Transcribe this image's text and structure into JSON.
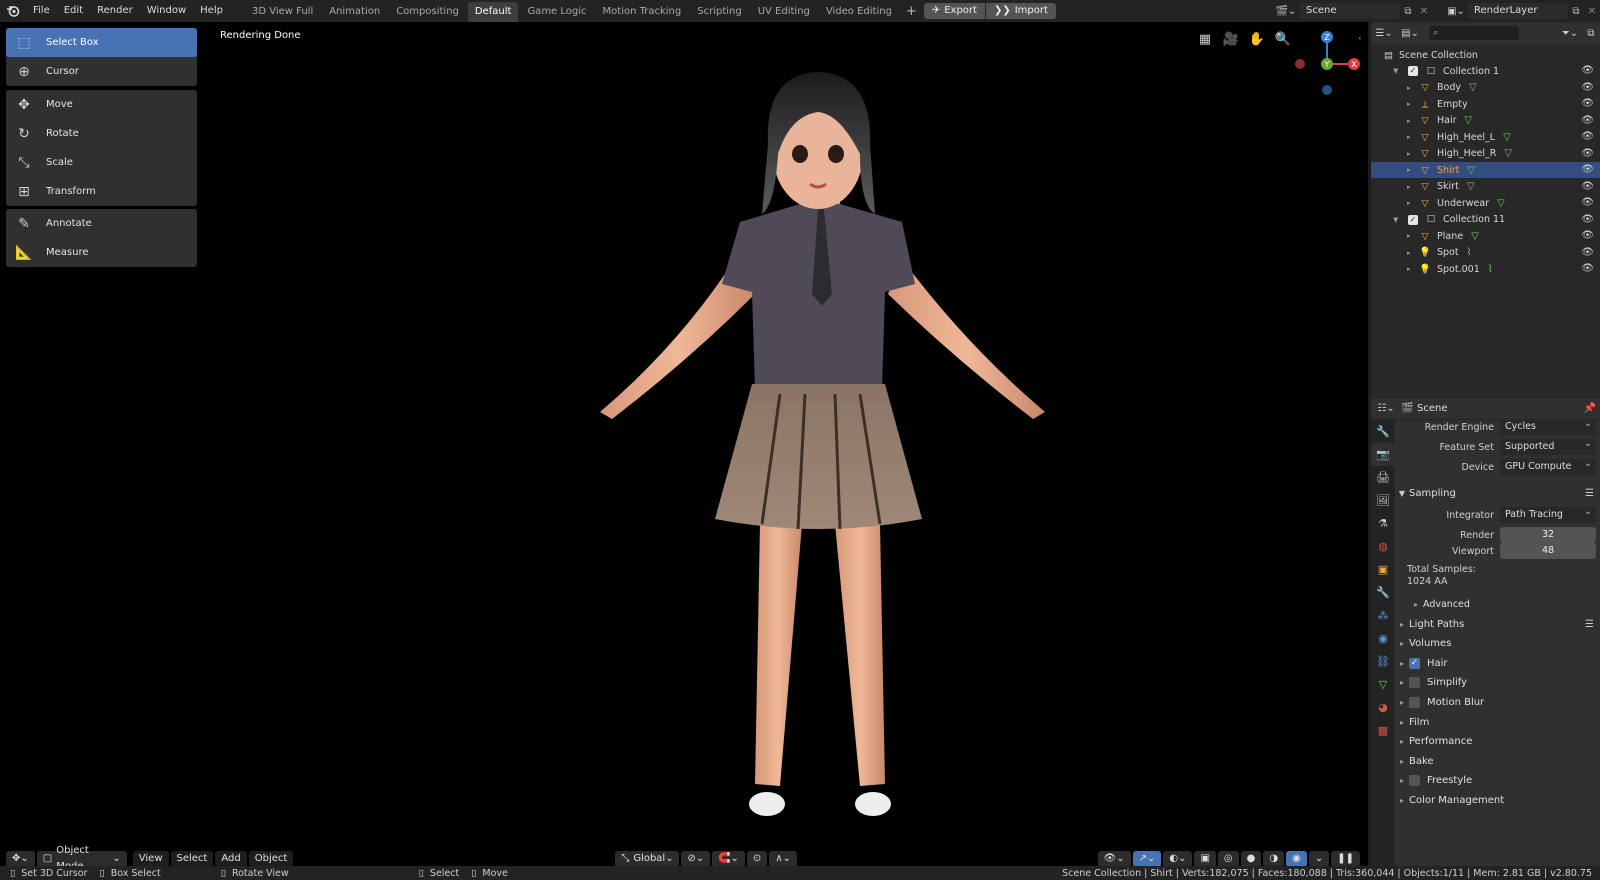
{
  "menu": [
    "File",
    "Edit",
    "Render",
    "Window",
    "Help"
  ],
  "workspace_tabs": [
    {
      "label": "3D View Full",
      "active": false
    },
    {
      "label": "Animation",
      "active": false
    },
    {
      "label": "Compositing",
      "active": false
    },
    {
      "label": "Default",
      "active": true
    },
    {
      "label": "Game Logic",
      "active": false
    },
    {
      "label": "Motion Tracking",
      "active": false
    },
    {
      "label": "Scripting",
      "active": false
    },
    {
      "label": "UV Editing",
      "active": false
    },
    {
      "label": "Video Editing",
      "active": false
    }
  ],
  "topbar": {
    "export_label": "Export",
    "import_label": "Import",
    "scene_name": "Scene",
    "render_layer": "RenderLayer"
  },
  "viewport": {
    "status_text": "Rendering Done",
    "gizmo": {
      "z": "Z",
      "y": "Y",
      "x": "X"
    },
    "header": {
      "mode": "Object Mode",
      "view": "View",
      "select": "Select",
      "add": "Add",
      "object": "Object",
      "orientation": "Global"
    }
  },
  "toolbar": {
    "group1": [
      {
        "label": "Select Box",
        "icon": "select-box-icon",
        "active": true
      },
      {
        "label": "Cursor",
        "icon": "cursor-icon",
        "active": false
      }
    ],
    "group2": [
      {
        "label": "Move",
        "icon": "move-icon"
      },
      {
        "label": "Rotate",
        "icon": "rotate-icon"
      },
      {
        "label": "Scale",
        "icon": "scale-icon"
      },
      {
        "label": "Transform",
        "icon": "transform-icon"
      }
    ],
    "group3": [
      {
        "label": "Annotate",
        "icon": "annotate-icon"
      },
      {
        "label": "Measure",
        "icon": "measure-icon"
      }
    ]
  },
  "outliner": {
    "root": "Scene Collection",
    "items": [
      {
        "name": "Collection 1",
        "type": "collection",
        "depth": 1,
        "selected": false
      },
      {
        "name": "Body",
        "type": "mesh",
        "depth": 2,
        "selected": false
      },
      {
        "name": "Empty",
        "type": "empty",
        "depth": 2,
        "selected": false
      },
      {
        "name": "Hair",
        "type": "mesh",
        "depth": 2,
        "selected": false
      },
      {
        "name": "High_Heel_L",
        "type": "mesh",
        "depth": 2,
        "selected": false
      },
      {
        "name": "High_Heel_R",
        "type": "mesh",
        "depth": 2,
        "selected": false
      },
      {
        "name": "Shirt",
        "type": "mesh",
        "depth": 2,
        "selected": true
      },
      {
        "name": "Skirt",
        "type": "mesh",
        "depth": 2,
        "selected": false
      },
      {
        "name": "Underwear",
        "type": "mesh",
        "depth": 2,
        "selected": false
      },
      {
        "name": "Collection 11",
        "type": "collection",
        "depth": 1,
        "selected": false
      },
      {
        "name": "Plane",
        "type": "mesh",
        "depth": 2,
        "selected": false
      },
      {
        "name": "Spot",
        "type": "light",
        "depth": 2,
        "selected": false
      },
      {
        "name": "Spot.001",
        "type": "light",
        "depth": 2,
        "selected": false
      }
    ]
  },
  "properties": {
    "scene_label": "Scene",
    "render_engine_label": "Render Engine",
    "render_engine": "Cycles",
    "feature_set_label": "Feature Set",
    "feature_set": "Supported",
    "device_label": "Device",
    "device": "GPU Compute",
    "sampling": "Sampling",
    "integrator_label": "Integrator",
    "integrator": "Path Tracing",
    "render_label": "Render",
    "render_samples": "32",
    "viewport_label": "Viewport",
    "viewport_samples": "48",
    "total_samples_label": "Total Samples:",
    "total_samples_value": "1024 AA",
    "advanced": "Advanced",
    "sections": [
      {
        "label": "Light Paths",
        "checkbox": null
      },
      {
        "label": "Volumes",
        "checkbox": null
      },
      {
        "label": "Hair",
        "checkbox": true
      },
      {
        "label": "Simplify",
        "checkbox": false
      },
      {
        "label": "Motion Blur",
        "checkbox": false
      },
      {
        "label": "Film",
        "checkbox": null
      },
      {
        "label": "Performance",
        "checkbox": null
      },
      {
        "label": "Bake",
        "checkbox": null
      },
      {
        "label": "Freestyle",
        "checkbox": false
      },
      {
        "label": "Color Management",
        "checkbox": null
      }
    ]
  },
  "statusbar": {
    "left": [
      {
        "label": "Set 3D Cursor"
      },
      {
        "label": "Box Select"
      },
      {
        "label": "Rotate View"
      },
      {
        "label": "Select"
      },
      {
        "label": "Move"
      }
    ],
    "right": "Scene Collection | Shirt | Verts:182,075 | Faces:180,088 | Tris:360,044 | Objects:1/11 | Mem: 2.81 GB | v2.80.75"
  },
  "colors": {
    "accent": "#4772b3",
    "selected_object": "#f3a63b",
    "background": "#1d1d1d",
    "viewport": "#010101"
  }
}
